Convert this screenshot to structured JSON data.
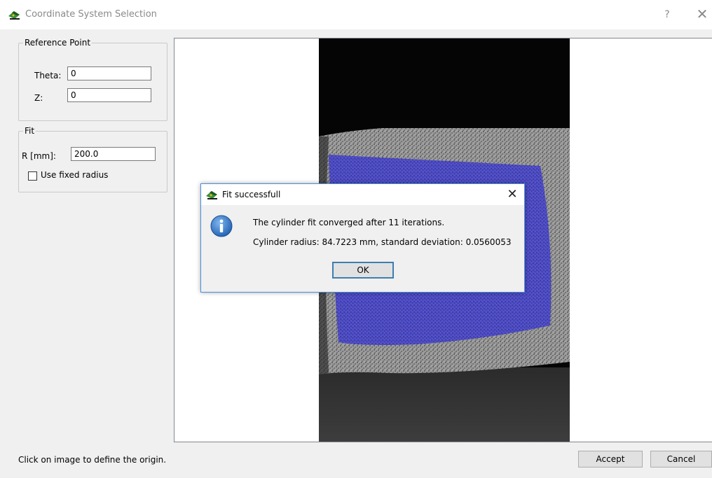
{
  "window": {
    "title": "Coordinate System Selection",
    "help_glyph": "?",
    "close_glyph": "✕"
  },
  "reference_point": {
    "group_title": "Reference Point",
    "theta_label": "Theta:",
    "theta_value": "0",
    "z_label": "Z:",
    "z_value": "0"
  },
  "fit": {
    "group_title": "Fit",
    "radius_label": "R [mm]:",
    "radius_value": "200.0",
    "use_fixed_radius_label": "Use fixed radius",
    "use_fixed_radius_checked": false
  },
  "status": {
    "text": "Click on image to define the origin."
  },
  "buttons": {
    "accept": "Accept",
    "cancel": "Cancel"
  },
  "message_box": {
    "title": "Fit successfull",
    "close_glyph": "✕",
    "line1": "The cylinder fit converged after 11 iterations.",
    "line2": "Cylinder radius: 84.7223 mm, standard deviation: 0.0560053",
    "ok": "OK"
  },
  "icons": {
    "app": "app-logo-icon",
    "info": "info-icon"
  },
  "colors": {
    "selection_overlay": "#4a48c8",
    "focus_border": "#3c7fb1"
  }
}
